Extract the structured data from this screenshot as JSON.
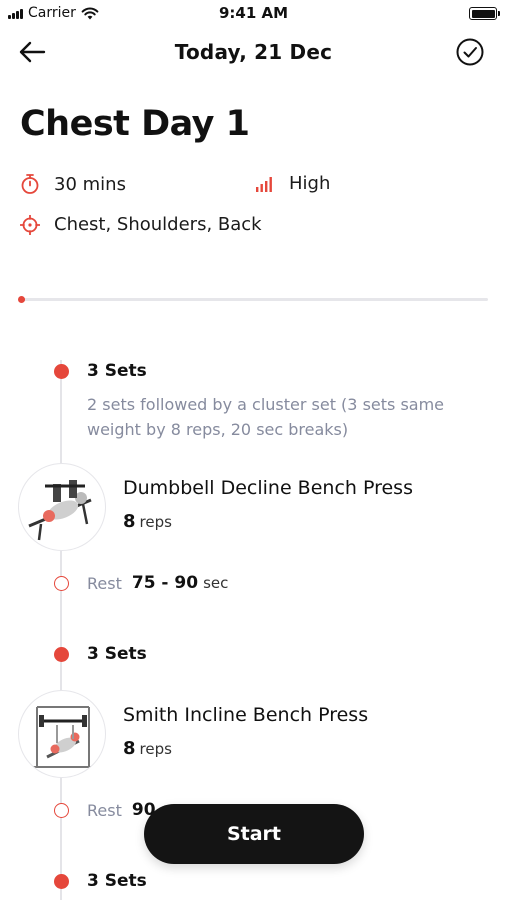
{
  "status_bar": {
    "carrier": "Carrier",
    "time": "9:41 AM"
  },
  "header": {
    "title": "Today, 21 Dec"
  },
  "workout": {
    "title": "Chest Day 1",
    "duration": "30 mins",
    "intensity": "High",
    "muscles": "Chest, Shoulders, Back",
    "progress_fraction": 0.01
  },
  "sets": [
    {
      "label": "3 Sets",
      "description": "2 sets followed by a cluster set (3 sets same weight by 8 reps, 20 sec breaks)",
      "exercise": {
        "name": "Dumbbell Decline Bench Press",
        "reps_value": "8",
        "reps_unit": "reps"
      },
      "rest": {
        "label": "Rest",
        "value": "75 - 90",
        "unit": "sec"
      }
    },
    {
      "label": "3 Sets",
      "exercise": {
        "name": "Smith Incline Bench Press",
        "reps_value": "8",
        "reps_unit": "reps"
      },
      "rest": {
        "label": "Rest",
        "value": "90",
        "unit": ""
      }
    },
    {
      "label": "3 Sets"
    }
  ],
  "start_button": {
    "label": "Start"
  },
  "colors": {
    "accent": "#e5473b",
    "muted_text": "#868b9e",
    "button_bg": "#141414"
  },
  "icons": {
    "back": "arrow-left-icon",
    "done": "check-circle-icon",
    "duration": "stopwatch-icon",
    "intensity": "signal-bars-icon",
    "muscles": "crosshair-icon"
  }
}
